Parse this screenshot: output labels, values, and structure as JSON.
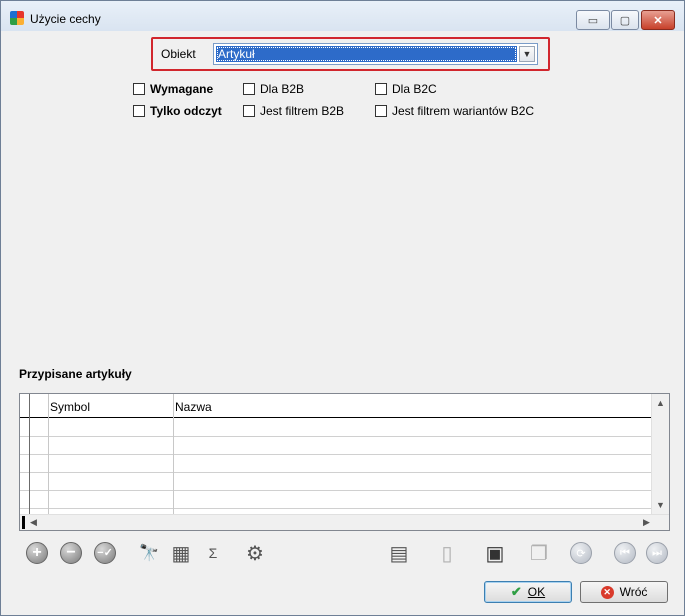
{
  "window": {
    "title": "Użycie cechy",
    "controls": {
      "minimize": "▭",
      "maximize": "▢",
      "close": "✕"
    }
  },
  "object_picker": {
    "label": "Obiekt",
    "selected": "Artykuł",
    "highlight_color": "#d1262d"
  },
  "options": {
    "required": "Wymagane",
    "read_only": "Tylko odczyt",
    "for_b2b": "Dla B2B",
    "b2b_filter": "Jest filtrem B2B",
    "for_b2c": "Dla B2C",
    "b2c_variant_filter": "Jest filtrem wariantów B2C"
  },
  "assigned": {
    "title": "Przypisane artykuły",
    "columns": {
      "symbol": "Symbol",
      "name": "Nazwa"
    },
    "rows": []
  },
  "toolbar_icons": [
    "add-icon",
    "remove-icon",
    "remove-selected-icon",
    "binoculars-icon",
    "table-grid-icon",
    "calculator-icon",
    "settings-gears-icon",
    "report-icon",
    "document-icon",
    "save-icon",
    "windows-icon",
    "refresh-icon",
    "first-record-icon",
    "last-record-icon"
  ],
  "buttons": {
    "ok": "OK",
    "back": "Wróć"
  }
}
